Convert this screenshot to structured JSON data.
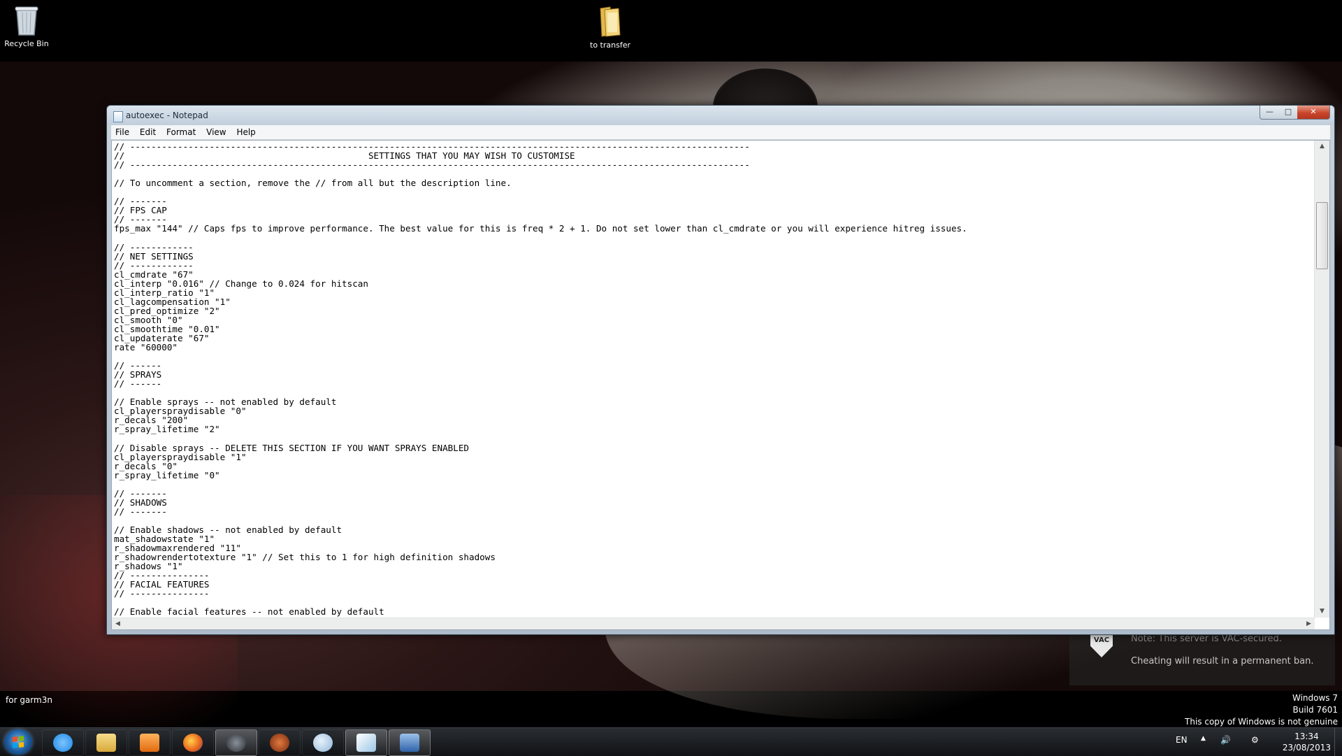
{
  "desktop": {
    "icons": [
      {
        "label": "Recycle Bin",
        "icon": "recycle-bin-icon"
      },
      {
        "label": "to transfer",
        "icon": "folder-icon"
      }
    ],
    "user_label": "for garm3n",
    "vac": {
      "badge": "VAC",
      "line1": "Note: This server is VAC-secured.",
      "line2": "Cheating will result in a permanent ban."
    },
    "watermark": {
      "line1": "Windows 7",
      "line2": "Build 7601",
      "line3": "This copy of Windows is not genuine"
    }
  },
  "notepad": {
    "title": "autoexec - Notepad",
    "menu": [
      "File",
      "Edit",
      "Format",
      "View",
      "Help"
    ],
    "content": "// ---------------------------------------------------------------------------------------------------------------------\n//                                              SETTINGS THAT YOU MAY WISH TO CUSTOMISE\n// ---------------------------------------------------------------------------------------------------------------------\n\n// To uncomment a section, remove the // from all but the description line.\n\n// -------\n// FPS CAP\n// -------\nfps_max \"144\" // Caps fps to improve performance. The best value for this is freq * 2 + 1. Do not set lower than cl_cmdrate or you will experience hitreg issues.\n\n// ------------\n// NET SETTINGS\n// ------------\ncl_cmdrate \"67\"\ncl_interp \"0.016\" // Change to 0.024 for hitscan\ncl_interp_ratio \"1\"\ncl_lagcompensation \"1\"\ncl_pred_optimize \"2\"\ncl_smooth \"0\"\ncl_smoothtime \"0.01\"\ncl_updaterate \"67\"\nrate \"60000\"\n\n// ------\n// SPRAYS\n// ------\n\n// Enable sprays -- not enabled by default\ncl_playerspraydisable \"0\"\nr_decals \"200\"\nr_spray_lifetime \"2\"\n\n// Disable sprays -- DELETE THIS SECTION IF YOU WANT SPRAYS ENABLED\ncl_playerspraydisable \"1\"\nr_decals \"0\"\nr_spray_lifetime \"0\"\n\n// -------\n// SHADOWS\n// -------\n\n// Enable shadows -- not enabled by default\nmat_shadowstate \"1\"\nr_shadowmaxrendered \"11\"\nr_shadowrendertotexture \"1\" // Set this to 1 for high definition shadows\nr_shadows \"1\"\n// ---------------\n// FACIAL FEATURES\n// ---------------\n\n// Enable facial features -- not enabled by default"
  },
  "taskbar": {
    "apps": [
      {
        "name": "internet-explorer",
        "color": "#1e88e5",
        "active": false
      },
      {
        "name": "windows-explorer",
        "color": "#e8c25a",
        "active": false
      },
      {
        "name": "media-player",
        "color": "#f08a2a",
        "active": false
      },
      {
        "name": "firefox",
        "color": "#e8601c",
        "active": false
      },
      {
        "name": "steam",
        "color": "#3a3f46",
        "active": true
      },
      {
        "name": "team-fortress-2",
        "color": "#b8562a",
        "active": false
      },
      {
        "name": "paint",
        "color": "#8fb6d8",
        "active": false
      },
      {
        "name": "notepad",
        "color": "#9cc6e6",
        "active": true
      },
      {
        "name": "remote-desktop",
        "color": "#4f86c8",
        "active": true
      }
    ],
    "tray": {
      "language": "EN",
      "time": "13:34",
      "date": "23/08/2013"
    }
  }
}
